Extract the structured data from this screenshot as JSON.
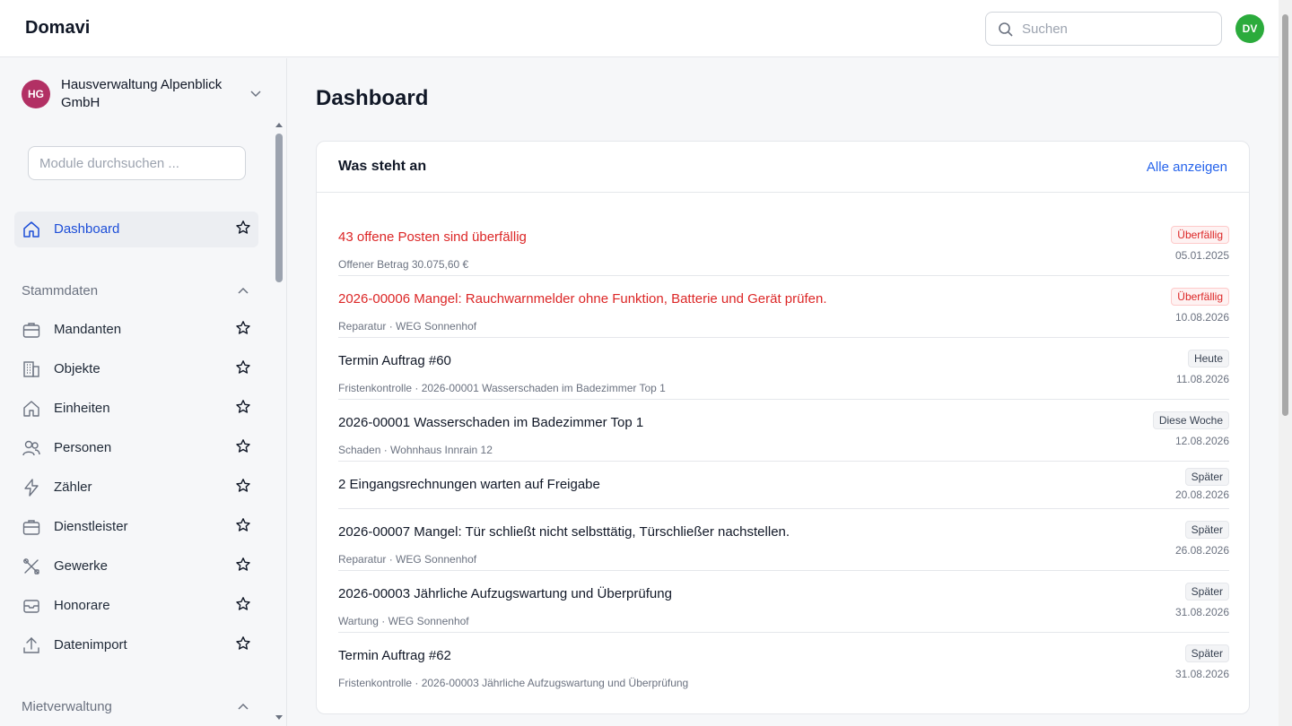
{
  "app": {
    "logo": "Domavi"
  },
  "header": {
    "search_placeholder": "Suchen",
    "user_initials": "DV"
  },
  "tenant": {
    "initials": "HG",
    "name": "Hausverwaltung Alpenblick GmbH"
  },
  "sidebar": {
    "module_search_placeholder": "Module durchsuchen ...",
    "dashboard_label": "Dashboard",
    "section_stammdaten": "Stammdaten",
    "items": [
      {
        "label": "Mandanten",
        "icon": "briefcase-icon"
      },
      {
        "label": "Objekte",
        "icon": "building-icon"
      },
      {
        "label": "Einheiten",
        "icon": "home-icon"
      },
      {
        "label": "Personen",
        "icon": "users-icon"
      },
      {
        "label": "Zähler",
        "icon": "bolt-icon"
      },
      {
        "label": "Dienstleister",
        "icon": "briefcase-icon"
      },
      {
        "label": "Gewerke",
        "icon": "tools-icon"
      },
      {
        "label": "Honorare",
        "icon": "inbox-icon"
      },
      {
        "label": "Datenimport",
        "icon": "upload-icon"
      }
    ],
    "section_mietverwaltung": "Mietverwaltung"
  },
  "main": {
    "title": "Dashboard",
    "card_title": "Was steht an",
    "show_all": "Alle anzeigen",
    "rows": [
      {
        "title": "43 offene Posten sind überfällig",
        "sub": "Offener Betrag 30.075,60 €",
        "badge": "Überfällig",
        "date": "05.01.2025",
        "overdue": true
      },
      {
        "title": "2026-00006 Mangel: Rauchwarnmelder ohne Funktion, Batterie und Gerät prüfen.",
        "sub": "Reparatur · WEG Sonnenhof",
        "badge": "Überfällig",
        "date": "10.08.2026",
        "overdue": true
      },
      {
        "title": "Termin Auftrag #60",
        "sub": "Fristenkontrolle · 2026-00001 Wasserschaden im Badezimmer Top 1",
        "badge": "Heute",
        "date": "11.08.2026",
        "overdue": false
      },
      {
        "title": "2026-00001 Wasserschaden im Badezimmer Top 1",
        "sub": "Schaden · Wohnhaus Innrain 12",
        "badge": "Diese Woche",
        "date": "12.08.2026",
        "overdue": false
      },
      {
        "title": "2 Eingangsrechnungen warten auf Freigabe",
        "sub": "",
        "badge": "Später",
        "date": "20.08.2026",
        "overdue": false
      },
      {
        "title": "2026-00007 Mangel: Tür schließt nicht selbsttätig, Türschließer nachstellen.",
        "sub": "Reparatur · WEG Sonnenhof",
        "badge": "Später",
        "date": "26.08.2026",
        "overdue": false
      },
      {
        "title": "2026-00003 Jährliche Aufzugswartung und Überprüfung",
        "sub": "Wartung · WEG Sonnenhof",
        "badge": "Später",
        "date": "31.08.2026",
        "overdue": false
      },
      {
        "title": "Termin Auftrag #62",
        "sub": "Fristenkontrolle · 2026-00003 Jährliche Aufzugswartung und Überprüfung",
        "badge": "Später",
        "date": "31.08.2026",
        "overdue": false
      }
    ]
  }
}
